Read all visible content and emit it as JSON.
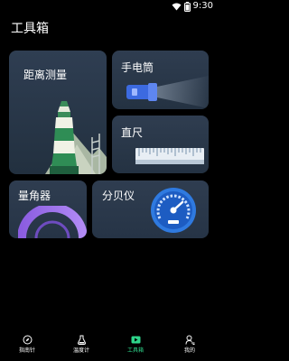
{
  "status_bar": {
    "time": "9:30"
  },
  "app": {
    "title": "工具箱"
  },
  "tools": {
    "distance": {
      "label": "距离测量"
    },
    "flashlight": {
      "label": "手电筒"
    },
    "ruler": {
      "label": "直尺"
    },
    "protractor": {
      "label": "量角器"
    },
    "decibel": {
      "label": "分贝仪"
    }
  },
  "bottom_nav": {
    "items": [
      {
        "label": "指南针",
        "icon": "compass-icon",
        "active": false
      },
      {
        "label": "温度计",
        "icon": "thermometer-icon",
        "active": false
      },
      {
        "label": "工具箱",
        "icon": "toolbox-icon",
        "active": true
      },
      {
        "label": "我的",
        "icon": "profile-icon",
        "active": false
      }
    ]
  },
  "colors": {
    "accent": "#2ed48a",
    "card": "#2b394b",
    "background": "#000000"
  }
}
